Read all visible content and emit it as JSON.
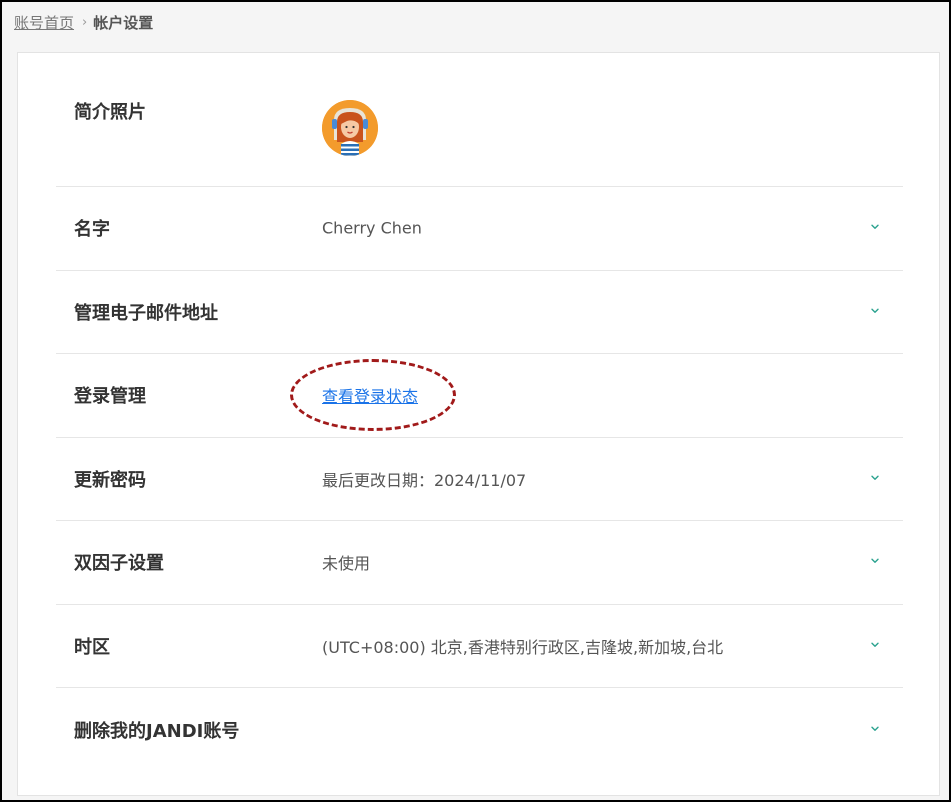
{
  "breadcrumb": {
    "home": "账号首页",
    "separator": "›",
    "current": "帐户设置"
  },
  "settings": {
    "profile_photo": {
      "label": "简介照片"
    },
    "name": {
      "label": "名字",
      "value": "Cherry Chen"
    },
    "email": {
      "label": "管理电子邮件地址"
    },
    "login": {
      "label": "登录管理",
      "link": "查看登录状态"
    },
    "password": {
      "label": "更新密码",
      "value": "最后更改日期：2024/11/07"
    },
    "two_factor": {
      "label": "双因子设置",
      "value": "未使用"
    },
    "timezone": {
      "label": "时区",
      "value": "(UTC+08:00) 北京,香港特别行政区,吉隆坡,新加坡,台北"
    },
    "delete": {
      "label": "删除我的JANDI账号"
    }
  },
  "colors": {
    "accent_chevron": "#2aa28f",
    "link": "#1a73e8",
    "annotation": "#a11a1a",
    "avatar_bg": "#f39b2c"
  },
  "icons": {
    "chevron": "chevron-down-icon",
    "avatar": "avatar"
  }
}
